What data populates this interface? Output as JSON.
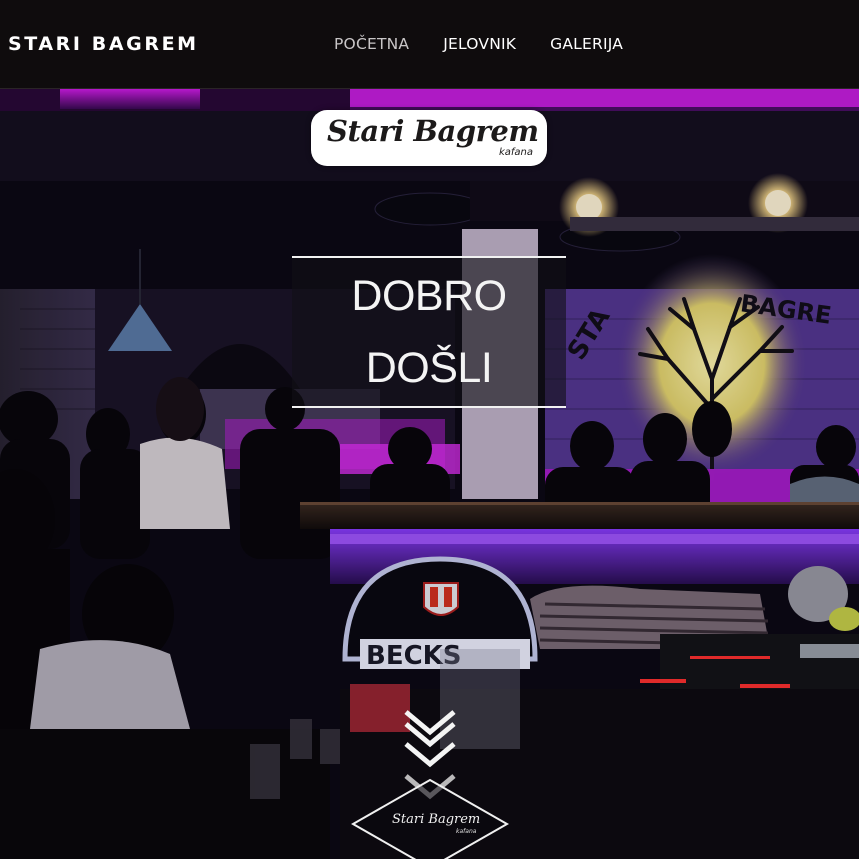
{
  "header": {
    "brand": "STARI BAGREM",
    "nav": [
      {
        "label": "POČETNA",
        "active": true
      },
      {
        "label": "JELOVNIK",
        "active": false
      },
      {
        "label": "GALERIJA",
        "active": false
      }
    ]
  },
  "hero": {
    "logo_title": "Stari Bagrem",
    "logo_subtitle": "kafana",
    "welcome_line1": "DOBRO",
    "welcome_line2": "DOŠLI",
    "bottom_logo_title": "Stari Bagrem",
    "bottom_logo_subtitle": "kafana",
    "wall_sign": "STARI BAGREM",
    "bar_sign": "BECKS"
  },
  "icons": {
    "scroll": "chevron-down-icon",
    "tree": "tree-icon"
  },
  "colors": {
    "nav_bg": "#0f0c0d",
    "neon_magenta": "#c21bd8",
    "neon_violet": "#6a2cf0",
    "text_white": "#ffffff"
  }
}
